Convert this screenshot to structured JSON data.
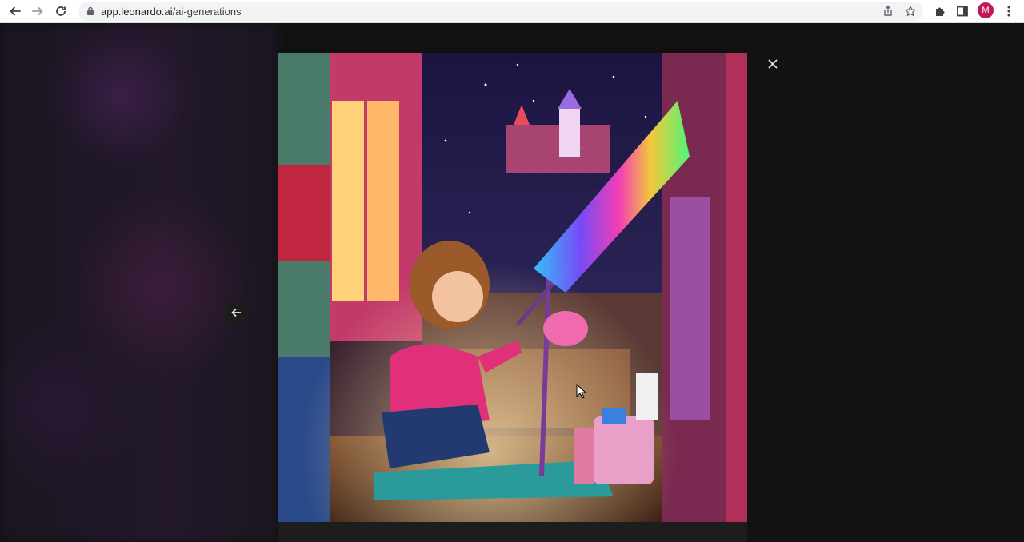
{
  "browser": {
    "url_host": "app.leonardo.ai",
    "url_path": "/ai-generations",
    "avatar_initial": "M",
    "avatar_color": "#c2185b",
    "icons": [
      "back-arrow-icon",
      "forward-arrow-icon",
      "reload-icon",
      "lock-icon",
      "share-icon",
      "star-icon",
      "puzzle-icon",
      "sidepanel-icon",
      "menu-dots-icon"
    ]
  },
  "viewer": {
    "icons": [
      "close-icon",
      "left-arrow-icon"
    ]
  }
}
